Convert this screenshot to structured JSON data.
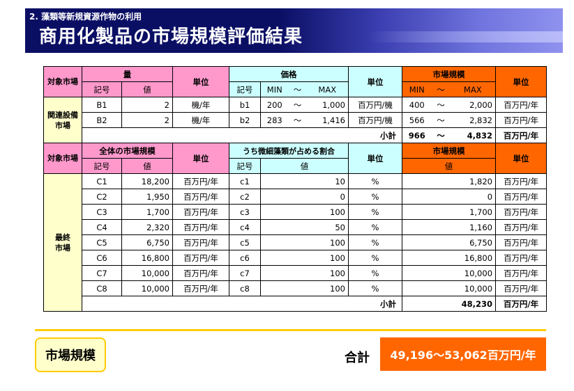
{
  "header": {
    "subtitle": "2. 藻類等新規資源作物の利用",
    "title": "商用化製品の市場規模評価結果"
  },
  "colors": {
    "header_bg": "#0b0f64",
    "pink": "#ff99cc",
    "cyan": "#ccffff",
    "orange": "#ff6600",
    "gold": "#ffcc00"
  },
  "section1": {
    "target_label": "対象市場",
    "quantity_label": "量",
    "symbol_label": "記号",
    "value_label": "値",
    "unit_label": "単位",
    "price_label": "価格",
    "min_label": "MIN",
    "tilde": "～",
    "max_label": "MAX",
    "market_label": "市場規模",
    "group_label": "関連設備市場",
    "rows": [
      {
        "code": "B1",
        "value": "2",
        "unit": "機/年",
        "pcode": "b1",
        "pmin": "200",
        "pmax": "1,000",
        "punit": "百万円/機",
        "mmin": "400",
        "mmax": "2,000",
        "munit": "百万円/年"
      },
      {
        "code": "B2",
        "value": "2",
        "unit": "機/年",
        "pcode": "b2",
        "pmin": "283",
        "pmax": "1,416",
        "punit": "百万円/機",
        "mmin": "566",
        "mmax": "2,832",
        "munit": "百万円/年"
      }
    ],
    "subtotal_label": "小計",
    "subtotal_min": "966",
    "subtotal_max": "4,832",
    "subtotal_unit": "百万円/年"
  },
  "section2": {
    "target_label": "対象市場",
    "whole_label": "全体の市場規模",
    "symbol_label": "記号",
    "value_label": "値",
    "unit_label": "単位",
    "share_label": "うち微細藻類が占める割合",
    "market_label": "市場規模",
    "group_label": "最終市場",
    "rows": [
      {
        "code": "C1",
        "value": "18,200",
        "unit": "百万円/年",
        "scode": "c1",
        "share": "10",
        "sunit": "%",
        "market": "1,820",
        "munit": "百万円/年"
      },
      {
        "code": "C2",
        "value": "1,950",
        "unit": "百万円/年",
        "scode": "c2",
        "share": "0",
        "sunit": "%",
        "market": "0",
        "munit": "百万円/年"
      },
      {
        "code": "C3",
        "value": "1,700",
        "unit": "百万円/年",
        "scode": "c3",
        "share": "100",
        "sunit": "%",
        "market": "1,700",
        "munit": "百万円/年"
      },
      {
        "code": "C4",
        "value": "2,320",
        "unit": "百万円/年",
        "scode": "c4",
        "share": "50",
        "sunit": "%",
        "market": "1,160",
        "munit": "百万円/年"
      },
      {
        "code": "C5",
        "value": "6,750",
        "unit": "百万円/年",
        "scode": "c5",
        "share": "100",
        "sunit": "%",
        "market": "6,750",
        "munit": "百万円/年"
      },
      {
        "code": "C6",
        "value": "16,800",
        "unit": "百万円/年",
        "scode": "c6",
        "share": "100",
        "sunit": "%",
        "market": "16,800",
        "munit": "百万円/年"
      },
      {
        "code": "C7",
        "value": "10,000",
        "unit": "百万円/年",
        "scode": "c7",
        "share": "100",
        "sunit": "%",
        "market": "10,000",
        "munit": "百万円/年"
      },
      {
        "code": "C8",
        "value": "10,000",
        "unit": "百万円/年",
        "scode": "c8",
        "share": "100",
        "sunit": "%",
        "market": "10,000",
        "munit": "百万円/年"
      }
    ],
    "subtotal_label": "小計",
    "subtotal_value": "48,230",
    "subtotal_unit": "百万円/年"
  },
  "footer": {
    "market_label": "市場規模",
    "total_label": "合計",
    "total_value": "49,196～53,062百万円/年"
  }
}
